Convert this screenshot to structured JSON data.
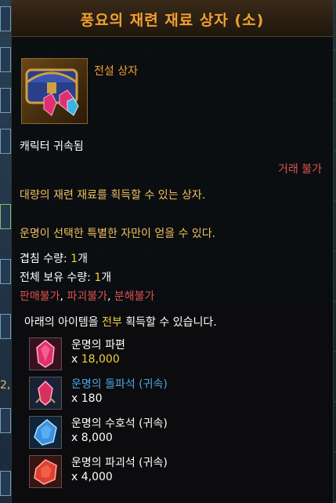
{
  "tooltip": {
    "title": "풍요의 재련 재료 상자 (소)",
    "grade": "전설 상자",
    "bound": "캐릭터 귀속됨",
    "trade": "거래 불가",
    "desc_line1": "대량의 재련 재료를 획득할 수 있는 상자.",
    "desc_line2": "운명이 선택한 특별한 자만이 얻을 수 있다.",
    "stack_label": "겹침 수량: ",
    "stack_value": "1",
    "stack_unit": "개",
    "owned_label": "전체 보유 수량: ",
    "owned_value": "1",
    "owned_unit": "개",
    "restrictions": [
      "판매불가",
      "파괴불가",
      "분해불가"
    ],
    "restriction_sep": ", "
  },
  "rewards": {
    "head_prefix": "아래의 아이템을 ",
    "head_highlight": "전부",
    "head_suffix": " 획득할 수 있습니다.",
    "items": [
      {
        "name": "운명의 파편",
        "qty_prefix": "x ",
        "qty": "18,000",
        "name_color": "#ffffff",
        "icon": "fate-shard-icon",
        "icon_color": "#e0306a"
      },
      {
        "name": "운명의 돌파석 (귀속)",
        "qty_prefix": "x ",
        "qty": "180",
        "name_color": "#4aa6e6",
        "icon": "fate-breakthrough-stone-icon",
        "icon_color": "#d83060"
      },
      {
        "name": "운명의 수호석 (귀속)",
        "qty_prefix": "x ",
        "qty": "8,000",
        "name_color": "#ffffff",
        "icon": "fate-guardian-stone-icon",
        "icon_color": "#3a90e0"
      },
      {
        "name": "운명의 파괴석 (귀속)",
        "qty_prefix": "x ",
        "qty": "4,000",
        "name_color": "#ffffff",
        "icon": "fate-destruction-stone-icon",
        "icon_color": "#e04030"
      }
    ]
  },
  "left_panel": {
    "number": "2,"
  },
  "colors": {
    "title": "#f0a030",
    "legendary": "#f0a030",
    "warning": "#e05050",
    "desc": "#f0c060",
    "value": "#f0d040"
  }
}
